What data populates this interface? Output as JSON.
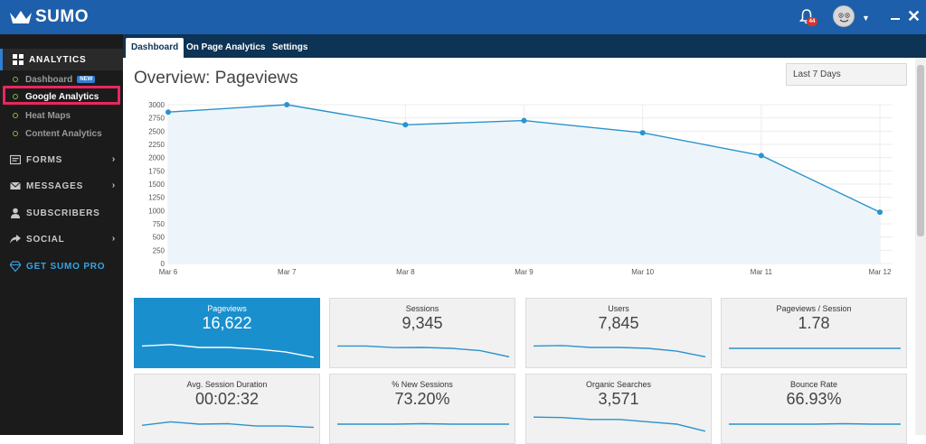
{
  "app": {
    "name": "SUMO",
    "notification_count": "44"
  },
  "sidebar": {
    "analytics": "ANALYTICS",
    "sub": [
      {
        "label": "Dashboard",
        "badge": "NEW"
      },
      {
        "label": "Google Analytics"
      },
      {
        "label": "Heat Maps"
      },
      {
        "label": "Content Analytics"
      }
    ],
    "sections": [
      {
        "label": "FORMS"
      },
      {
        "label": "MESSAGES"
      },
      {
        "label": "SUBSCRIBERS"
      },
      {
        "label": "SOCIAL"
      },
      {
        "label": "GET SUMO PRO"
      }
    ]
  },
  "tabs": [
    {
      "label": "Dashboard"
    },
    {
      "label": "On Page Analytics"
    },
    {
      "label": "Settings"
    }
  ],
  "main": {
    "title": "Overview: Pageviews",
    "date_range": "Last 7 Days"
  },
  "chart_data": {
    "type": "area",
    "categories": [
      "Mar 6",
      "Mar 7",
      "Mar 8",
      "Mar 9",
      "Mar 10",
      "Mar 11",
      "Mar 12"
    ],
    "series": [
      {
        "values": [
          2860,
          3000,
          2620,
          2700,
          2470,
          2040,
          970
        ]
      }
    ],
    "yticks": [
      "3000",
      "2750",
      "2500",
      "2250",
      "2000",
      "1750",
      "1500",
      "1250",
      "1000",
      "750",
      "500",
      "250",
      "0"
    ],
    "ylim": [
      0,
      3000
    ],
    "grid": true,
    "colors": {
      "line": "#2a93cc",
      "fill": "#eef5fa"
    }
  },
  "cards": [
    {
      "label": "Pageviews",
      "value": "16,622",
      "spark": [
        0.6,
        0.66,
        0.54,
        0.54,
        0.47,
        0.35,
        0.12
      ]
    },
    {
      "label": "Sessions",
      "value": "9,345",
      "spark": [
        0.6,
        0.6,
        0.53,
        0.54,
        0.5,
        0.4,
        0.14
      ]
    },
    {
      "label": "Users",
      "value": "7,845",
      "spark": [
        0.6,
        0.62,
        0.54,
        0.54,
        0.5,
        0.38,
        0.14
      ]
    },
    {
      "label": "Pageviews / Session",
      "value": "1.78",
      "spark": [
        0.5,
        0.5,
        0.5,
        0.5,
        0.5,
        0.5,
        0.5
      ]
    },
    {
      "label": "Avg. Session Duration",
      "value": "00:02:32",
      "spark": [
        0.45,
        0.6,
        0.5,
        0.52,
        0.42,
        0.42,
        0.36
      ]
    },
    {
      "label": "% New Sessions",
      "value": "73.20%",
      "spark": [
        0.5,
        0.5,
        0.5,
        0.52,
        0.5,
        0.5,
        0.5
      ]
    },
    {
      "label": "Organic Searches",
      "value": "3,571",
      "spark": [
        0.8,
        0.78,
        0.7,
        0.7,
        0.6,
        0.5,
        0.2
      ]
    },
    {
      "label": "Bounce Rate",
      "value": "66.93%",
      "spark": [
        0.5,
        0.5,
        0.5,
        0.5,
        0.52,
        0.5,
        0.5
      ]
    }
  ]
}
